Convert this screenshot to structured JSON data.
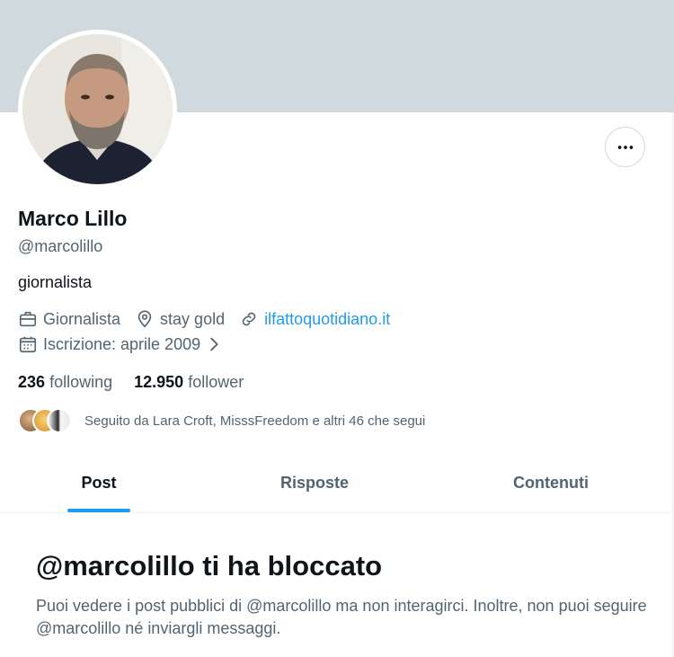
{
  "profile": {
    "name": "Marco Lillo",
    "handle": "@marcolillo",
    "bio": "giornalista",
    "profession": "Giornalista",
    "location": "stay gold",
    "website": "ilfattoquotidiano.it",
    "joined": "Iscrizione: aprile 2009"
  },
  "stats": {
    "following_count": "236",
    "following_label": "following",
    "followers_count": "12.950",
    "followers_label": "follower"
  },
  "followed_by": "Seguito da Lara Croft, MisssFreedom e altri 46 che segui",
  "tabs": [
    {
      "label": "Post",
      "active": true
    },
    {
      "label": "Risposte",
      "active": false
    },
    {
      "label": "Contenuti",
      "active": false
    }
  ],
  "blocked": {
    "title": "@marcolillo ti ha bloccato",
    "message": "Puoi vedere i post pubblici di @marcolillo ma non interagirci. Inoltre, non puoi seguire @marcolillo né inviargli messaggi."
  },
  "icons": {
    "more": "more-horizontal-icon",
    "profession": "briefcase-icon",
    "location": "location-pin-icon",
    "website": "link-icon",
    "joined": "calendar-icon",
    "chevron": "chevron-right-icon"
  },
  "colors": {
    "banner": "#cfd9de",
    "accent": "#1d9bf0",
    "primary_text": "#0f1419",
    "secondary_text": "#536471"
  }
}
